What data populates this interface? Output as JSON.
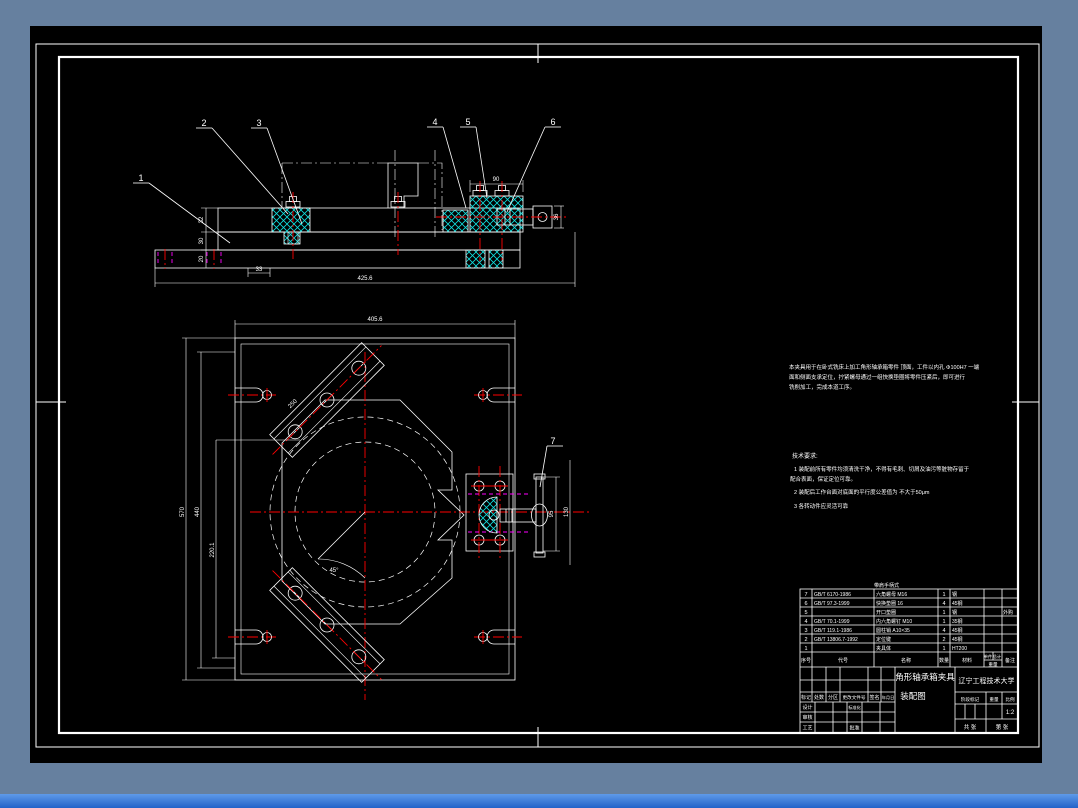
{
  "window": {
    "background_color": "#66809f",
    "canvas_color": "#000000",
    "line_color": "#ffffff",
    "centerline_color": "#ff0000",
    "hatch_color": "#10dede",
    "hidden_line_color": "#ff00ff",
    "bottom_bar_color": "#2262c8"
  },
  "callouts": {
    "c1": "1",
    "c2": "2",
    "c3": "3",
    "c4": "4",
    "c5": "5",
    "c6": "6",
    "c7": "7"
  },
  "dimensions": {
    "front": {
      "overall": "425.6",
      "width_right": "90",
      "handle_height": "36",
      "h_top": "32",
      "h_mid": "30",
      "h_bottom": "20",
      "offset_left": "33"
    },
    "plan": {
      "overall_top": "405.6",
      "height_total": "570",
      "height_mid": "440",
      "height_inner": "220.1",
      "bar_length": "250",
      "angle": "45°",
      "clamp_height": "95",
      "clamp_total": "130"
    }
  },
  "notes": {
    "paragraph": [
      "本夹具用于在卧式铣床上加工角形轴承箱零件 顶面，工件以内孔 Φ100H7 一端",
      "面和侧面支承定位，拧紧螺母通过一组快换垫圈将零件压紧后，即可进行",
      "铣削加工，完成本道工序。"
    ],
    "tech_title": "技术要求:",
    "tech_items": [
      "1 装配前所有零件均须清洗干净，不得有毛刺、切屑及油污等脏物存留于",
      "   配合表面，保证定位可靠。",
      "2 装配后工作台面对底面的平行度公差值为 不大于50μm",
      "3 各转动件应灵活可靠"
    ]
  },
  "title_block": {
    "overflow_text": "带肩手柄式",
    "bom": {
      "headers": {
        "no": "序号",
        "code": "代号",
        "name": "名称",
        "qty": "数量",
        "material": "材料",
        "weight": "重量",
        "weight_each": "单件",
        "weight_total": "总计",
        "remark": "备注"
      },
      "rows": [
        {
          "no": "7",
          "code": "GB/T 6170-1986",
          "name": "六角螺母 M16",
          "qty": "1",
          "mat": "钢",
          "remark": ""
        },
        {
          "no": "6",
          "code": "GB/T 97.3-1999",
          "name": "快换垫圈 16",
          "qty": "4",
          "mat": "45钢",
          "remark": ""
        },
        {
          "no": "5",
          "code": "",
          "name": "开口垫圈",
          "qty": "1",
          "mat": "钢",
          "remark": "外购"
        },
        {
          "no": "4",
          "code": "GB/T 70.1-1999",
          "name": "内六角螺钉 M10",
          "qty": "1",
          "mat": "35钢",
          "remark": ""
        },
        {
          "no": "3",
          "code": "GB/T 119.1-1986",
          "name": "圆柱销 A10×35",
          "qty": "4",
          "mat": "45钢",
          "remark": ""
        },
        {
          "no": "2",
          "code": "GB/T 13806.7-1992",
          "name": "定位键",
          "qty": "2",
          "mat": "45钢",
          "remark": ""
        },
        {
          "no": "1",
          "code": "",
          "name": "夹具体",
          "qty": "1",
          "mat": "HT200",
          "remark": ""
        }
      ]
    },
    "revision_labels": {
      "mark": "标记",
      "count": "处数",
      "zone": "分区",
      "doc_no": "更改文件号",
      "sign": "签名",
      "date": "年月日"
    },
    "sign_rows": {
      "design": "设计",
      "check": "审核",
      "craft": "工艺",
      "standard": "标准化",
      "approve": "批准"
    },
    "stage_mark": "阶段标记",
    "weight": "重量",
    "scale": "比例",
    "scale_value": "1:2",
    "sheet_total": "共 张",
    "sheet_no": "第 张",
    "title_line1": "角形轴承箱夹具",
    "title_line2": "装配图",
    "organization": "辽宁工程技术大学"
  }
}
